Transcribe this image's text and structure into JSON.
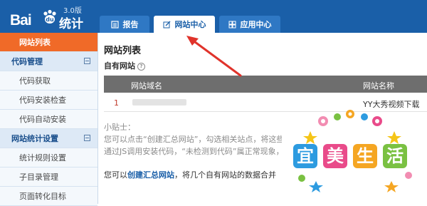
{
  "header": {
    "logo_text": "Bai",
    "logo_suffix": "统计",
    "version": "3.0版",
    "tabs": [
      {
        "label": "报告",
        "icon": "report-icon",
        "active": false
      },
      {
        "label": "网站中心",
        "icon": "edit-icon",
        "active": true
      },
      {
        "label": "应用中心",
        "icon": "grid-icon",
        "active": false
      }
    ]
  },
  "sidebar": {
    "items": [
      {
        "label": "网站列表",
        "kind": "active"
      },
      {
        "label": "代码管理",
        "kind": "group"
      },
      {
        "label": "代码获取",
        "kind": "sub"
      },
      {
        "label": "代码安装检查",
        "kind": "sub"
      },
      {
        "label": "代码自动安装",
        "kind": "sub"
      },
      {
        "label": "网站统计设置",
        "kind": "group"
      },
      {
        "label": "统计规则设置",
        "kind": "sub"
      },
      {
        "label": "子目录管理",
        "kind": "sub"
      },
      {
        "label": "页面转化目标",
        "kind": "sub"
      }
    ]
  },
  "main": {
    "title": "网站列表",
    "subtitle": "自有网站",
    "help_glyph": "?",
    "table": {
      "headers": [
        "网站域名",
        "网站名称"
      ],
      "rows": [
        {
          "index": "1",
          "name": "YY大秀视频下载"
        }
      ]
    },
    "tips": {
      "title": "小贴士：",
      "line1": "您可以点击“创建汇总网站”，勾选相关站点，将这些",
      "line2": "通过JS调用安装代码，“未检测到代码”属正常现象，"
    },
    "bottom": {
      "prefix": "您可以",
      "link": "创建汇总网站",
      "suffix": "，将几个自有网站的数据合并"
    }
  },
  "watermark": {
    "chars": [
      "宜",
      "美",
      "生",
      "活"
    ],
    "colors": [
      "#2d9be0",
      "#e94b8a",
      "#f5a623",
      "#7ac142"
    ]
  },
  "colors": {
    "header_bg": "#1a5fa8",
    "sidebar_active": "#f06a28",
    "arrow": "#e0332b"
  }
}
